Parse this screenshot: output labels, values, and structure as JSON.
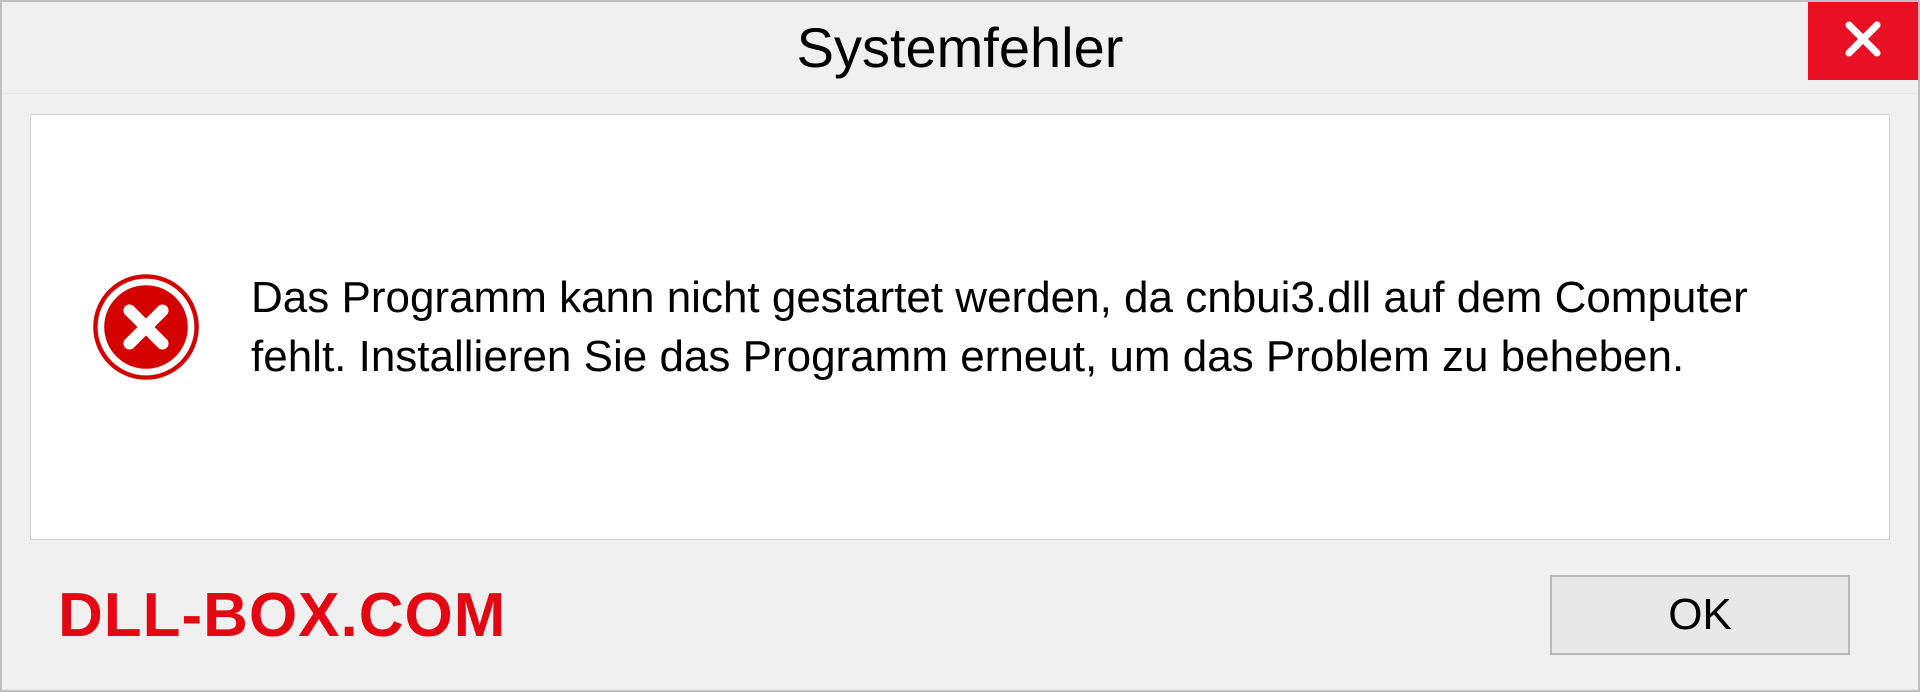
{
  "dialog": {
    "title": "Systemfehler",
    "message": "Das Programm kann nicht gestartet werden, da cnbui3.dll auf dem Computer fehlt. Installieren Sie das Programm erneut, um das Problem zu beheben.",
    "ok_label": "OK"
  },
  "watermark": "DLL-BOX.COM"
}
